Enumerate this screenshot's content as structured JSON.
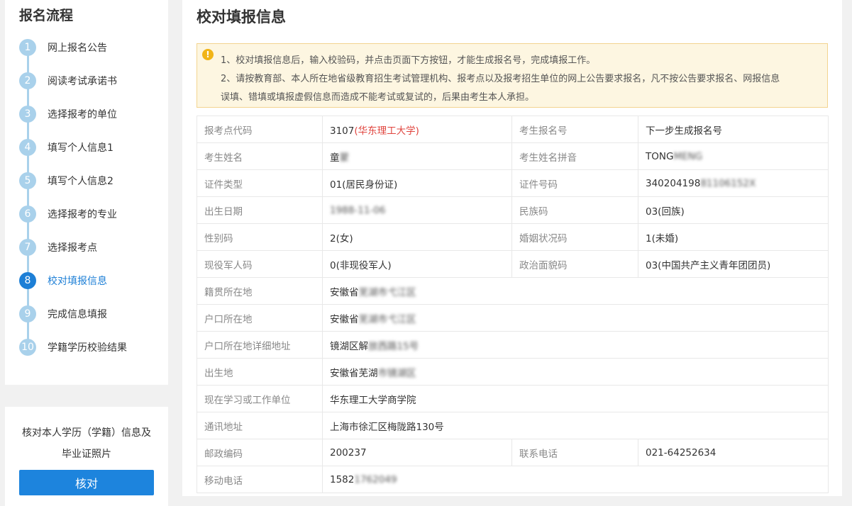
{
  "sidebar": {
    "title": "报名流程",
    "steps": [
      {
        "num": "1",
        "label": "网上报名公告"
      },
      {
        "num": "2",
        "label": "阅读考试承诺书"
      },
      {
        "num": "3",
        "label": "选择报考的单位"
      },
      {
        "num": "4",
        "label": "填写个人信息1"
      },
      {
        "num": "5",
        "label": "填写个人信息2"
      },
      {
        "num": "6",
        "label": "选择报考的专业"
      },
      {
        "num": "7",
        "label": "选择报考点"
      },
      {
        "num": "8",
        "label": "校对填报信息"
      },
      {
        "num": "9",
        "label": "完成信息填报"
      },
      {
        "num": "10",
        "label": "学籍学历校验结果"
      }
    ],
    "active_step": 8,
    "verify": {
      "text_line1": "核对本人学历（学籍）信息及",
      "text_line2": "毕业证照片",
      "button": "核对"
    }
  },
  "main": {
    "title": "校对填报信息",
    "notice": {
      "icon": "!",
      "line1": "1、校对填报信息后，输入校验码，并点击页面下方按钮，才能生成报名号，完成填报工作。",
      "line2": "2、请按教育部、本人所在地省级教育招生考试管理机构、报考点以及报考招生单位的网上公告要求报名，凡不按公告要求报名、网报信息",
      "line3": "误填、错填或填报虚假信息而造成不能考试或复试的，后果由考生本人承担。"
    },
    "table": {
      "exam_site_code_label": "报考点代码",
      "exam_site_code_value": "3107",
      "exam_site_name": "(华东理工大学)",
      "reg_no_label": "考生报名号",
      "reg_no_value": "下一步生成报名号",
      "name_label": "考生姓名",
      "name_value": "童",
      "name_value_blur": "蒙",
      "pinyin_label": "考生姓名拼音",
      "pinyin_value": "TONG",
      "pinyin_value_blur": "MENG",
      "id_type_label": "证件类型",
      "id_type_value": "01(居民身份证)",
      "id_no_label": "证件号码",
      "id_no_value": "340204198",
      "id_no_value_blur": "81106152X",
      "birth_label": "出生日期",
      "birth_value_blur": "1988-11-06",
      "ethnic_label": "民族码",
      "ethnic_value": "03(回族)",
      "gender_label": "性别码",
      "gender_value": "2(女)",
      "marital_label": "婚姻状况码",
      "marital_value": "1(未婚)",
      "military_label": "现役军人码",
      "military_value": "0(非现役军人)",
      "political_label": "政治面貌码",
      "political_value": "03(中国共产主义青年团团员)",
      "native_label": "籍贯所在地",
      "native_value": "安徽省",
      "native_value_blur": "芜湖市弋江区",
      "hukou_label": "户口所在地",
      "hukou_value": "安徽省",
      "hukou_value_blur": "芜湖市弋江区",
      "hukou_detail_label": "户口所在地详细地址",
      "hukou_detail_value": "镜湖区解",
      "hukou_detail_value_blur": "放西路15号",
      "birthplace_label": "出生地",
      "birthplace_value": "安徽省芜湖",
      "birthplace_value_blur": "市镜湖区",
      "workplace_label": "现在学习或工作单位",
      "workplace_value": "华东理工大学商学院",
      "address_label": "通讯地址",
      "address_value": "上海市徐汇区梅陇路130号",
      "postcode_label": "邮政编码",
      "postcode_value": "200237",
      "phone_label": "联系电话",
      "phone_value": "021-64252634",
      "mobile_label": "移动电话",
      "mobile_value": "1582",
      "mobile_value_blur": "1762049"
    }
  },
  "colors": {
    "accent": "#1d7fd6",
    "step_inactive": "#a9d1eb",
    "notice_bg": "#fdf6e1",
    "notice_border": "#f3d48f",
    "warning_icon": "#f1b416",
    "highlight_red": "#e0443e"
  }
}
